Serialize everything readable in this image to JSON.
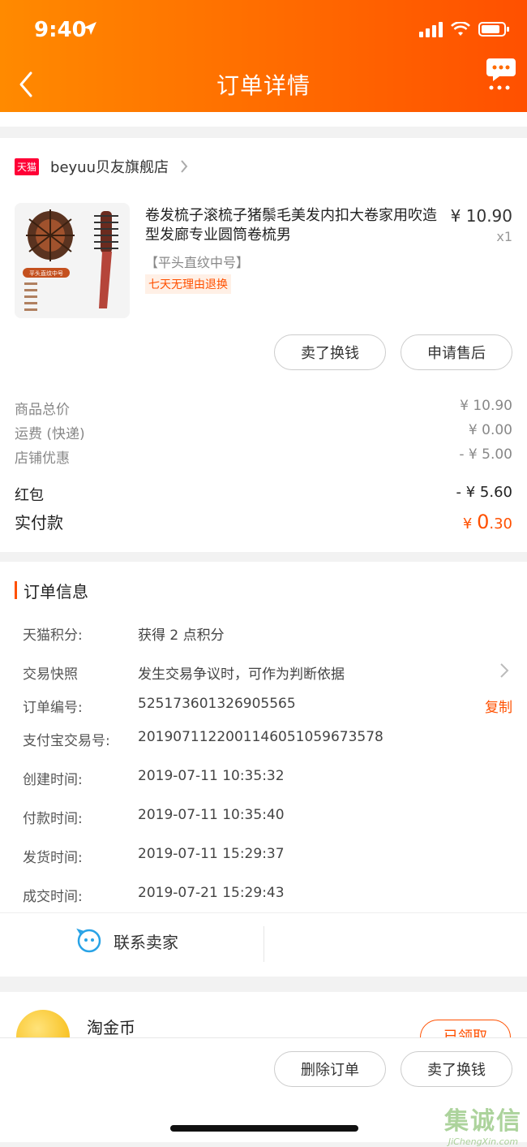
{
  "status_bar": {
    "time": "9:40"
  },
  "header": {
    "title": "订单详情"
  },
  "store": {
    "tag": "天猫",
    "name": "beyuu贝友旗舰店"
  },
  "product": {
    "title": "卷发梳子滚梳子猪鬃毛美发内扣大卷家用吹造型发廊专业圆筒卷梳男",
    "sku": "【平头直纹中号】",
    "return_tag": "七天无理由退换",
    "price": "¥ 10.90",
    "qty": "x1",
    "image_caption": "平头直纹中号"
  },
  "item_actions": {
    "sell": "卖了换钱",
    "after_sale": "申请售后"
  },
  "cost": {
    "items": [
      {
        "label": "商品总价",
        "value": "¥ 10.90"
      },
      {
        "label": "运费 (快递)",
        "value": "¥ 0.00"
      },
      {
        "label": "店铺优惠",
        "value": "- ¥ 5.00"
      }
    ],
    "red_packet": {
      "label": "红包",
      "value": "- ¥ 5.60"
    },
    "paid": {
      "label": "实付款",
      "currency": "¥ ",
      "int": "0",
      "dec": ".30"
    }
  },
  "order_info": {
    "title": "订单信息",
    "rows": [
      {
        "key": "天猫积分:",
        "value": "获得 2 点积分"
      },
      {
        "key": "交易快照",
        "value": "发生交易争议时，可作为判断依据"
      },
      {
        "key": "订单编号:",
        "value": "525173601326905565",
        "action": "复制"
      },
      {
        "key": "支付宝交易号:",
        "value": "2019071122001146051059673578"
      },
      {
        "key": "创建时间:",
        "value": "2019-07-11 10:35:32"
      },
      {
        "key": "付款时间:",
        "value": "2019-07-11 10:35:40"
      },
      {
        "key": "发货时间:",
        "value": "2019-07-11 15:29:37"
      },
      {
        "key": "成交时间:",
        "value": "2019-07-21 15:29:43"
      }
    ]
  },
  "contact": {
    "label": "联系卖家"
  },
  "coin": {
    "title": "淘金币",
    "button": "已领取"
  },
  "bottom_actions": {
    "delete": "删除订单",
    "sell": "卖了换钱"
  },
  "watermark": {
    "big": "集诚信",
    "small": "JiChengXin.com"
  },
  "colors": {
    "accent": "#ff5000",
    "header_start": "#ff8a00",
    "header_end": "#ff5000"
  }
}
